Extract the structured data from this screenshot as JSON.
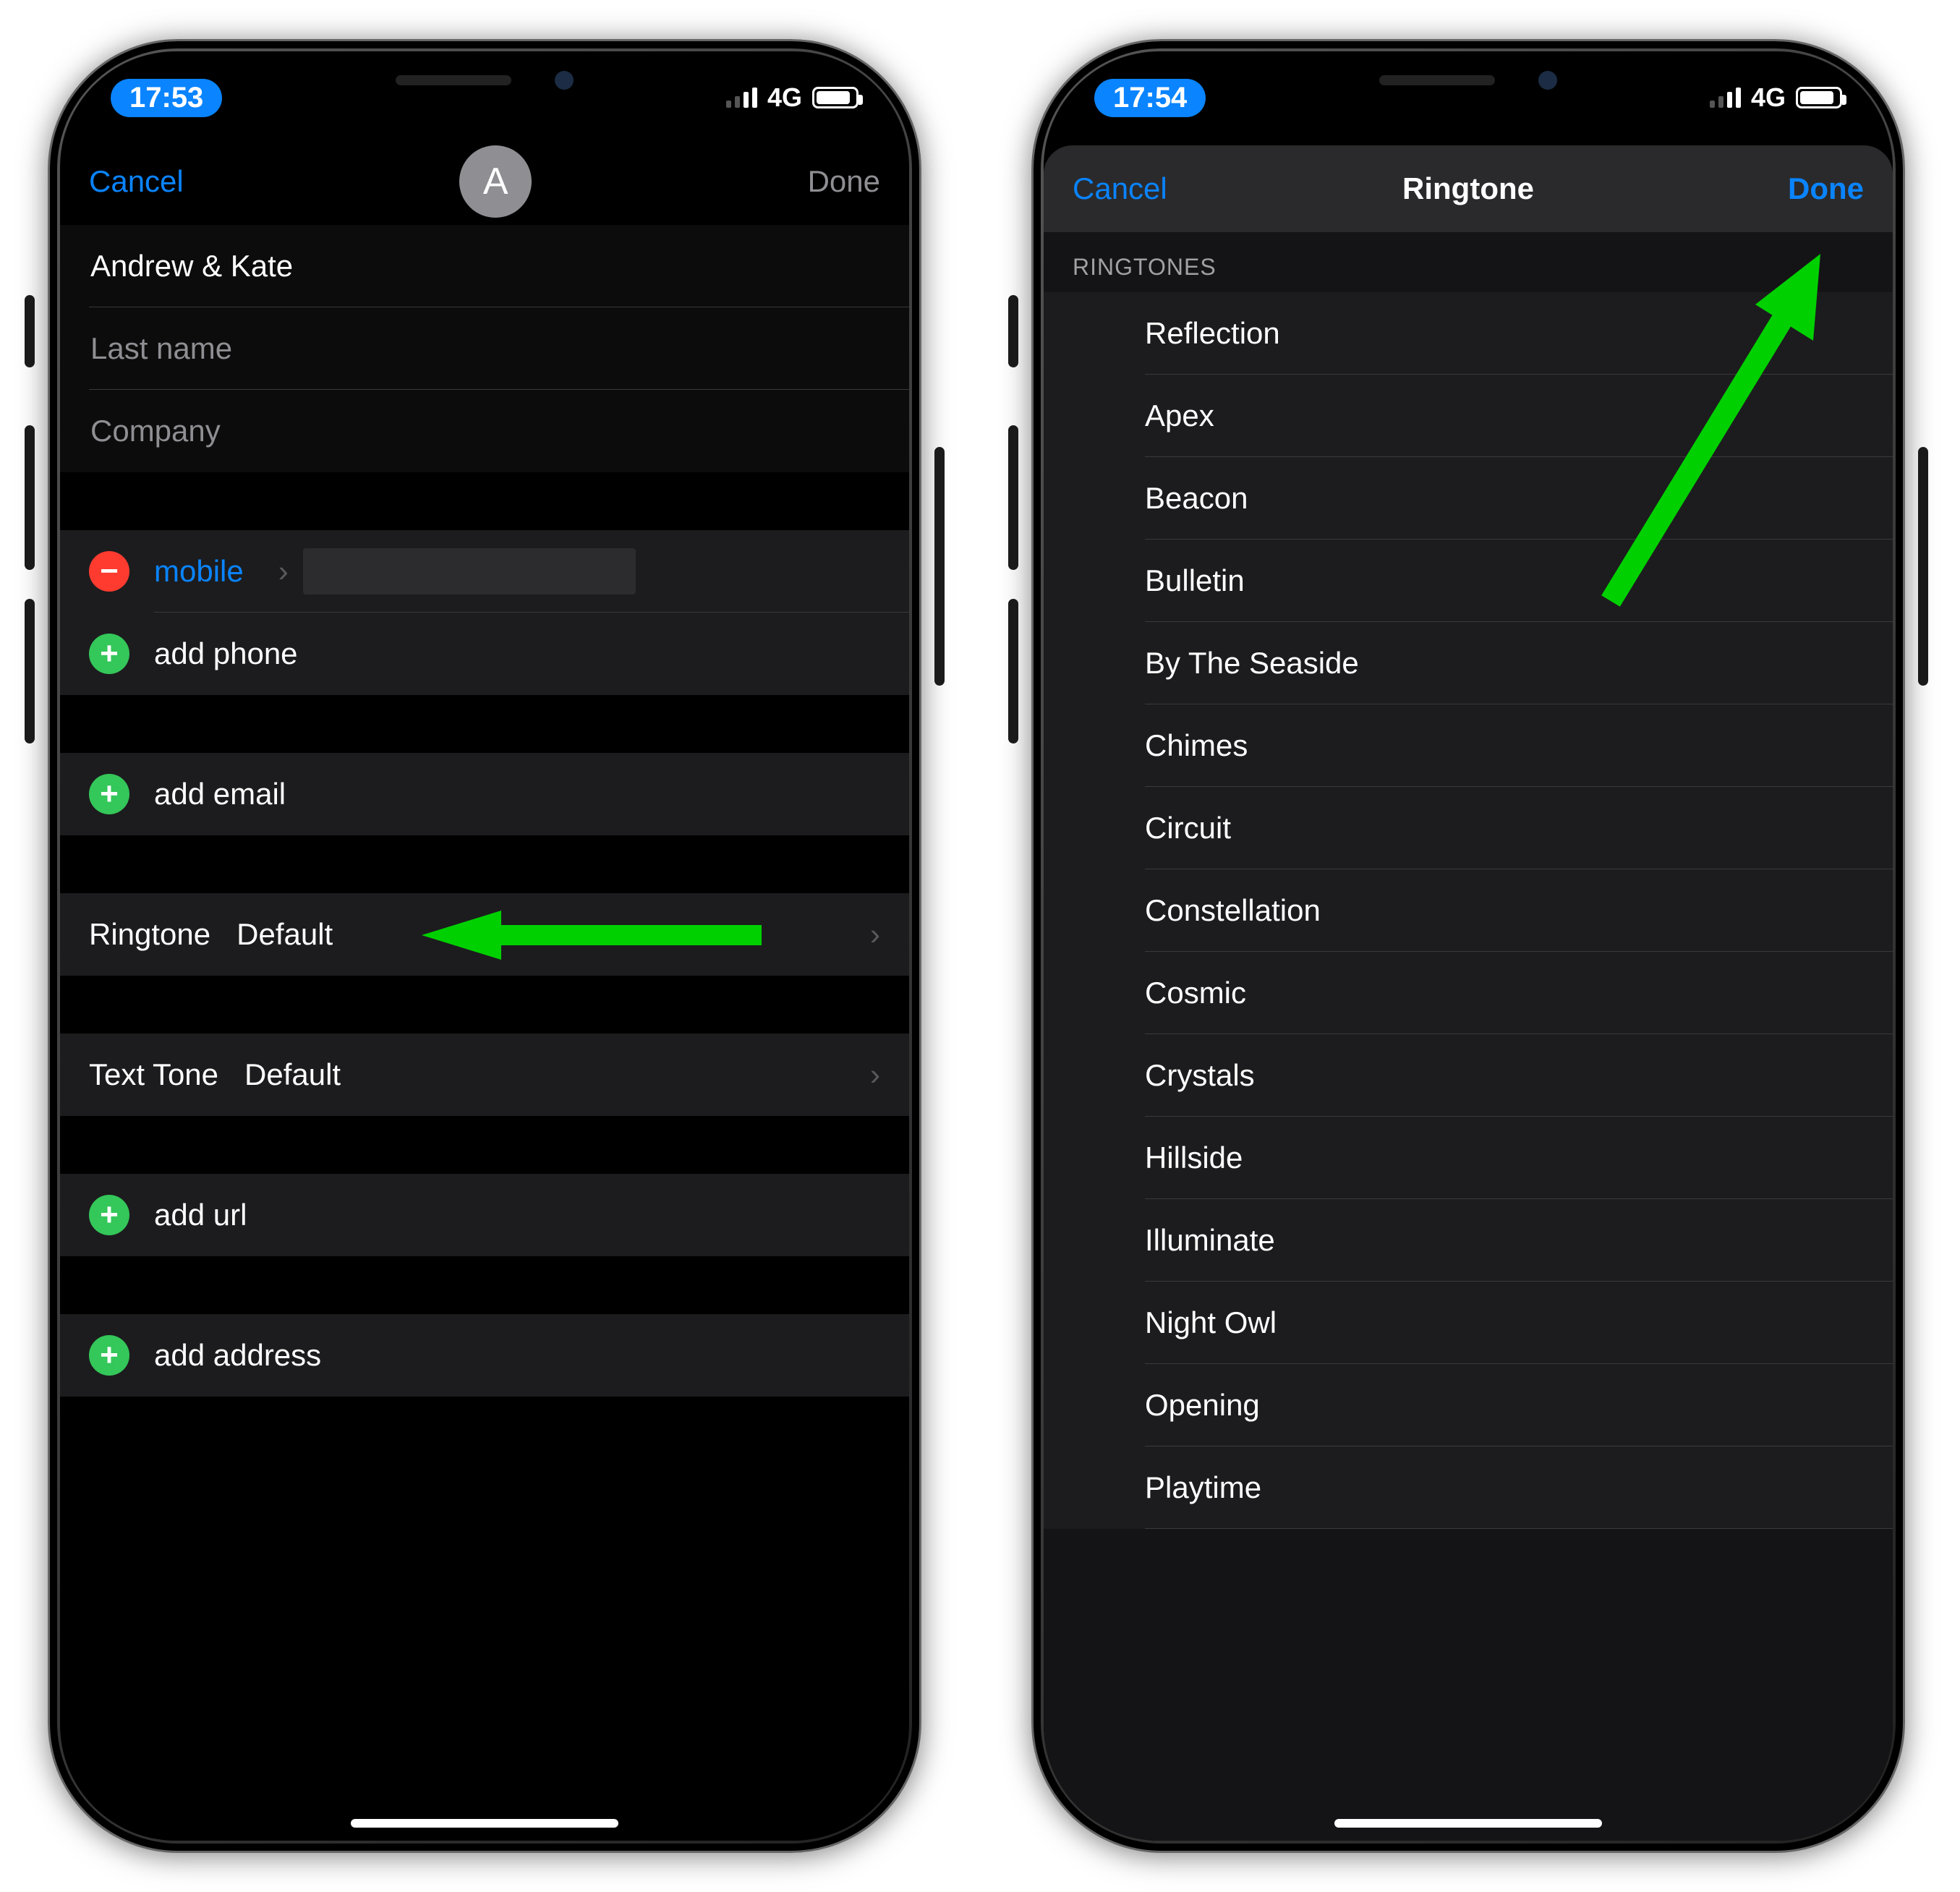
{
  "left": {
    "status": {
      "time": "17:53",
      "network": "4G"
    },
    "nav": {
      "cancel": "Cancel",
      "done": "Done",
      "avatar_initial": "A"
    },
    "fields": {
      "first_name_value": "Andrew & Kate",
      "last_name_placeholder": "Last name",
      "company_placeholder": "Company"
    },
    "phone": {
      "label": "mobile",
      "add_phone": "add phone"
    },
    "email": {
      "add_email": "add email"
    },
    "ringtone": {
      "label": "Ringtone",
      "value": "Default"
    },
    "texttone": {
      "label": "Text Tone",
      "value": "Default"
    },
    "url": {
      "add_url": "add url"
    },
    "address": {
      "add_address": "add address"
    }
  },
  "right": {
    "status": {
      "time": "17:54",
      "network": "4G"
    },
    "nav": {
      "cancel": "Cancel",
      "title": "Ringtone",
      "done": "Done"
    },
    "section_header": "RINGTONES",
    "ringtones": [
      "Reflection",
      "Apex",
      "Beacon",
      "Bulletin",
      "By The Seaside",
      "Chimes",
      "Circuit",
      "Constellation",
      "Cosmic",
      "Crystals",
      "Hillside",
      "Illuminate",
      "Night Owl",
      "Opening",
      "Playtime"
    ]
  }
}
